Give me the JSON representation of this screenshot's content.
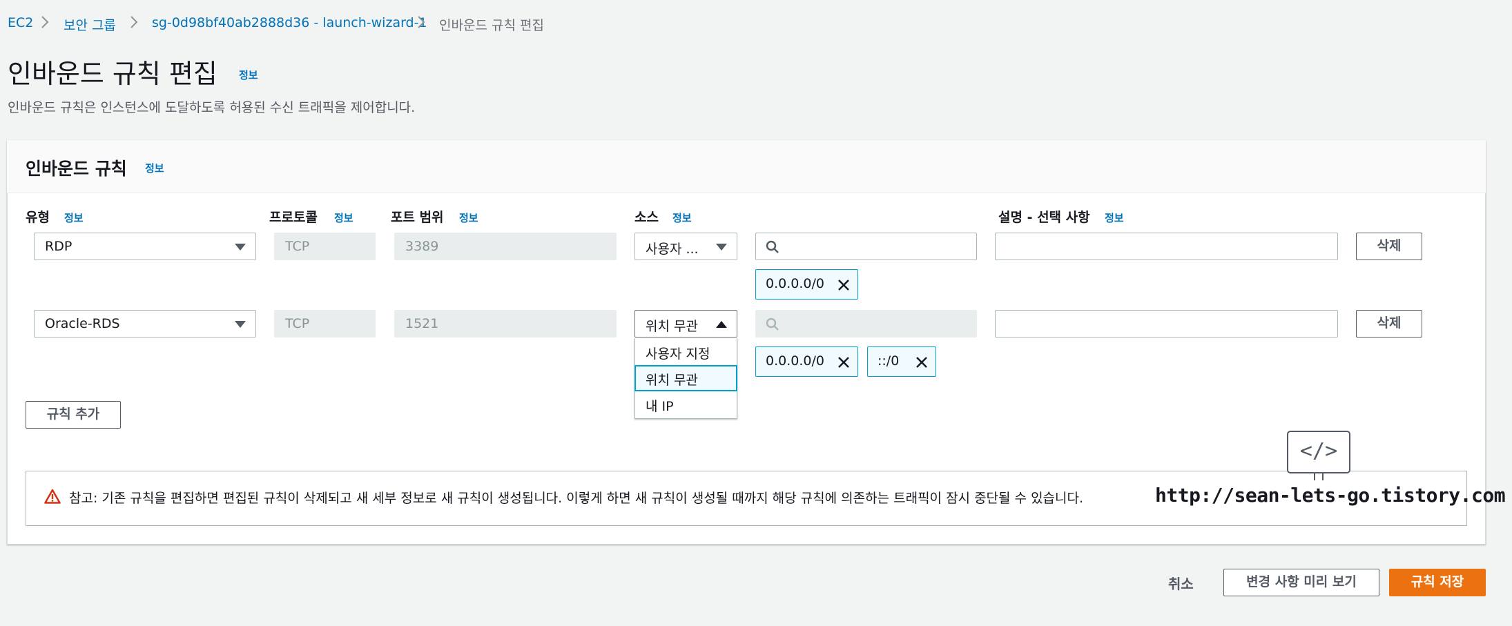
{
  "breadcrumb": {
    "items": [
      "EC2",
      "보안 그룹",
      "sg-0d98bf40ab2888d36 - launch-wizard-1"
    ],
    "current": "인바운드 규칙 편집"
  },
  "page": {
    "title": "인바운드 규칙 편집",
    "info": "정보",
    "subtitle": "인바운드 규칙은 인스턴스에 도달하도록 허용된 수신 트래픽을 제어합니다."
  },
  "panel": {
    "title": "인바운드 규칙",
    "info": "정보"
  },
  "columns": {
    "type": "유형",
    "protocol": "프로토콜",
    "port_range": "포트 범위",
    "source": "소스",
    "description": "설명 - 선택 사항",
    "info": "정보"
  },
  "rules": [
    {
      "type": "RDP",
      "protocol": "TCP",
      "port": "3389",
      "source": "사용자 ...",
      "search_value": "",
      "tokens": [
        "0.0.0.0/0"
      ],
      "description": "",
      "delete": "삭제"
    },
    {
      "type": "Oracle-RDS",
      "protocol": "TCP",
      "port": "1521",
      "source": "위치 무관",
      "search_value": "",
      "tokens": [
        "0.0.0.0/0",
        "::/0"
      ],
      "description": "",
      "delete": "삭제"
    }
  ],
  "source_dropdown": {
    "options": [
      "사용자 지정",
      "위치 무관",
      "내 IP"
    ],
    "selected": "위치 무관"
  },
  "add_rule": "규칙 추가",
  "alert": {
    "text": "참고: 기존 규칙을 편집하면 편집된 규칙이 삭제되고 새 세부 정보로 새 규칙이 생성됩니다. 이렇게 하면 새 규칙이 생성될 때까지 해당 규칙에 의존하는 트래픽이 잠시 중단될 수 있습니다."
  },
  "watermark": {
    "logo_text": "</>",
    "url": "http://sean-lets-go.tistory.com"
  },
  "footer": {
    "cancel": "취소",
    "preview": "변경 사항 미리 보기",
    "save": "규칙 저장"
  },
  "colors": {
    "link": "#0073bb",
    "primary": "#ec7211",
    "token_border": "#00a1c9",
    "alert_icon": "#d13212"
  }
}
